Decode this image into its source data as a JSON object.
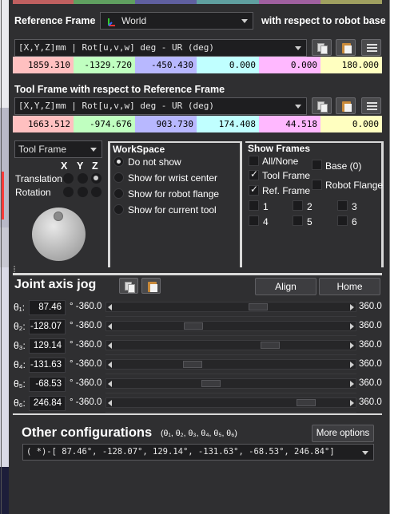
{
  "reference_frame": {
    "label": "Reference Frame",
    "selected": "World",
    "suffix": "with respect to robot base",
    "format": "[X,Y,Z]mm | Rot[u,v,w] deg   - UR (deg)",
    "values": [
      "1859.310",
      "-1329.720",
      "-450.430",
      "0.000",
      "0.000",
      "180.000"
    ]
  },
  "tool_frame": {
    "label": "Tool Frame with respect to Reference Frame",
    "format": "[X,Y,Z]mm | Rot[u,v,w] deg   - UR (deg)",
    "values": [
      "1663.512",
      "-974.676",
      "903.730",
      "174.408",
      "44.518",
      "0.000"
    ]
  },
  "cell_colors": [
    "#ffc0c0",
    "#c0ffc0",
    "#b8b8ff",
    "#c0ffff",
    "#ffb8ff",
    "#ffffc0"
  ],
  "jog": {
    "frame_select": "Tool Frame",
    "axes": [
      "X",
      "Y",
      "Z"
    ],
    "translation": "Translation",
    "rotation": "Rotation"
  },
  "workspace": {
    "title": "WorkSpace",
    "options": [
      "Do not show",
      "Show for wrist center",
      "Show for robot flange",
      "Show for current tool"
    ],
    "selected_index": 0
  },
  "show_frames": {
    "title": "Show Frames",
    "all_none": "All/None",
    "tool_frame": "Tool Frame",
    "ref_frame": "Ref. Frame",
    "base": "Base (0)",
    "robot_flange": "Robot Flange",
    "numbers": [
      "1",
      "2",
      "3",
      "4",
      "5",
      "6"
    ]
  },
  "joint_jog": {
    "title": "Joint axis jog",
    "align": "Align",
    "home": "Home",
    "min_label": "° -360.0",
    "max_label": "360.0",
    "joints": [
      {
        "label": "θ₁:",
        "value": "87.46",
        "deg": 87.46
      },
      {
        "label": "θ₂:",
        "value": "-128.07",
        "deg": -128.07
      },
      {
        "label": "θ₃:",
        "value": "129.14",
        "deg": 129.14
      },
      {
        "label": "θ₄:",
        "value": "-131.63",
        "deg": -131.63
      },
      {
        "label": "θ₅:",
        "value": "-68.53",
        "deg": -68.53
      },
      {
        "label": "θ₆:",
        "value": "246.84",
        "deg": 246.84
      }
    ]
  },
  "other_configs": {
    "title": "Other configurations",
    "subtitle": "(θ₁, θ₂, θ₃, θ₄, θ₅, θ₆)",
    "more": "More options",
    "selected": "( *)-[  87.46°, -128.07°,  129.14°, -131.63°,  -68.53°,  246.84°]"
  }
}
